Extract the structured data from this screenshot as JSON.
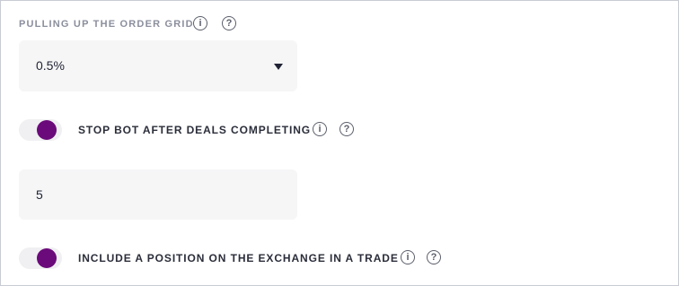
{
  "grid_section": {
    "label": "PULLING UP THE ORDER GRID",
    "select_value": "0.5%"
  },
  "stop_bot": {
    "label": "STOP BOT AFTER DEALS COMPLETING",
    "enabled": true,
    "input_value": "5"
  },
  "include_position": {
    "label": "INCLUDE A POSITION ON THE EXCHANGE IN A TRADE",
    "enabled": true
  },
  "icons": {
    "info_glyph": "i",
    "help_glyph": "?"
  },
  "colors": {
    "toggle_accent": "#6b0a7a",
    "label_muted": "#8b8f9c",
    "field_background": "#f6f6f7"
  }
}
